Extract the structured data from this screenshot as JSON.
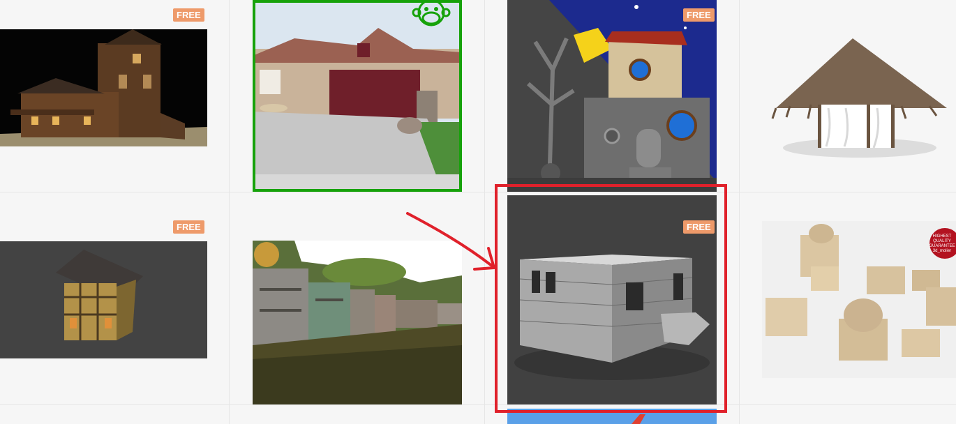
{
  "badge_label": "FREE",
  "colors": {
    "badge": "#ee9a6a",
    "selection_green": "#16a20a",
    "annotation_red": "#e0212b",
    "page_bg": "#f6f6f6"
  },
  "overlays": {
    "seal_text": "HIGHEST QUALITY GUARANTEE 3d_molier"
  }
}
